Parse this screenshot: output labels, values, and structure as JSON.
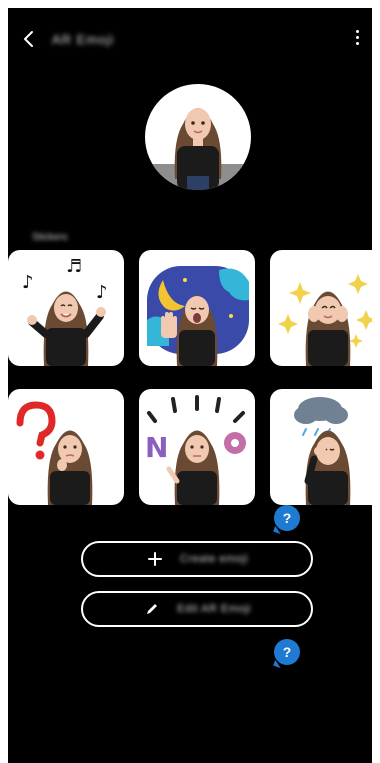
{
  "header": {
    "title": "AR Emoji",
    "back_icon": "chevron-left-icon",
    "more_icon": "more-vertical-icon"
  },
  "profile": {
    "avatar_icon": "avatar-portrait"
  },
  "stickers_section": {
    "label": "Stickers"
  },
  "stickers": [
    {
      "name": "sticker-music"
    },
    {
      "name": "sticker-sleepy-night"
    },
    {
      "name": "sticker-sparkles"
    },
    {
      "name": "sticker-question"
    },
    {
      "name": "sticker-no"
    },
    {
      "name": "sticker-rain-cloud"
    }
  ],
  "help": {
    "bubble_text_1": "?",
    "bubble_text_2": "?"
  },
  "actions": {
    "create_label": "Create emoji",
    "edit_label": "Edit AR Emoji",
    "create_icon": "plus-icon",
    "edit_icon": "pencil-icon"
  },
  "colors": {
    "background": "#000000",
    "card": "#ffffff",
    "accent": "#1f7ad1"
  }
}
